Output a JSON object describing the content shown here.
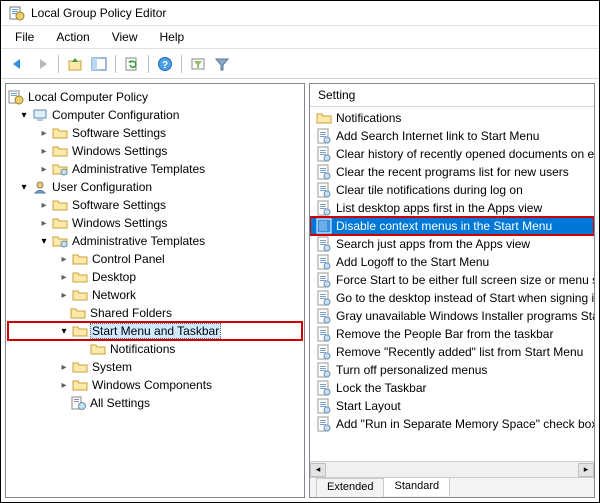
{
  "window": {
    "title": "Local Group Policy Editor"
  },
  "menubar": [
    "File",
    "Action",
    "View",
    "Help"
  ],
  "toolbar": {
    "buttons": [
      "back",
      "forward",
      "up",
      "window-tree",
      "refresh",
      "export",
      "help",
      "filter-view",
      "filter"
    ]
  },
  "tree": {
    "root": "Local Computer Policy",
    "computer_config": "Computer Configuration",
    "cc_software": "Software Settings",
    "cc_windows": "Windows Settings",
    "cc_admin": "Administrative Templates",
    "user_config": "User Configuration",
    "uc_software": "Software Settings",
    "uc_windows": "Windows Settings",
    "uc_admin": "Administrative Templates",
    "at_control_panel": "Control Panel",
    "at_desktop": "Desktop",
    "at_network": "Network",
    "at_shared": "Shared Folders",
    "at_start": "Start Menu and Taskbar",
    "at_start_notif": "Notifications",
    "at_system": "System",
    "at_wincomp": "Windows Components",
    "at_all": "All Settings"
  },
  "list": {
    "header": "Setting",
    "items": [
      {
        "type": "folder",
        "label": "Notifications"
      },
      {
        "type": "policy",
        "label": "Add Search Internet link to Start Menu"
      },
      {
        "type": "policy",
        "label": "Clear history of recently opened documents on exit"
      },
      {
        "type": "policy",
        "label": "Clear the recent programs list for new users"
      },
      {
        "type": "policy",
        "label": "Clear tile notifications during log on"
      },
      {
        "type": "policy",
        "label": "List desktop apps first in the Apps view"
      },
      {
        "type": "policy",
        "label": "Disable context menus in the Start Menu",
        "selected": true,
        "highlight": true
      },
      {
        "type": "policy",
        "label": "Search just apps from the Apps view"
      },
      {
        "type": "policy",
        "label": "Add Logoff to the Start Menu"
      },
      {
        "type": "policy",
        "label": "Force Start to be either full screen size or menu size"
      },
      {
        "type": "policy",
        "label": "Go to the desktop instead of Start when signing in"
      },
      {
        "type": "policy",
        "label": "Gray unavailable Windows Installer programs Start Menu"
      },
      {
        "type": "policy",
        "label": "Remove the People Bar from the taskbar"
      },
      {
        "type": "policy",
        "label": "Remove \"Recently added\" list from Start Menu"
      },
      {
        "type": "policy",
        "label": "Turn off personalized menus"
      },
      {
        "type": "policy",
        "label": "Lock the Taskbar"
      },
      {
        "type": "policy",
        "label": "Start Layout"
      },
      {
        "type": "policy",
        "label": "Add \"Run in Separate Memory Space\" check box to Run"
      }
    ]
  },
  "tabs": {
    "extended": "Extended",
    "standard": "Standard"
  }
}
